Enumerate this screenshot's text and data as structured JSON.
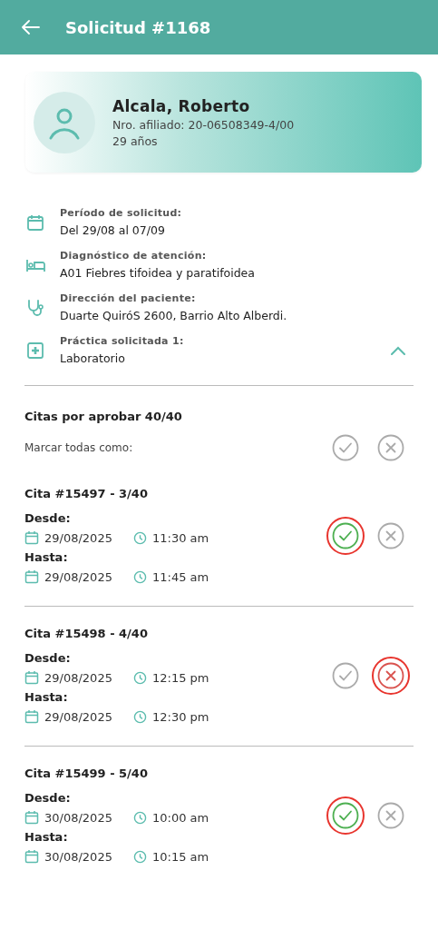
{
  "header": {
    "title": "Solicitud #1168"
  },
  "patient": {
    "name": "Alcala, Roberto",
    "affiliate": "Nro. afiliado: 20-06508349-4/00",
    "age": "29 años"
  },
  "details": [
    {
      "kind": "calendar",
      "label": "Período de solicitud:",
      "value": "Del 29/08 al 07/09"
    },
    {
      "kind": "bed",
      "label": "Diagnóstico de atención:",
      "value": "A01 Fiebres tifoidea y paratifoidea"
    },
    {
      "kind": "stethoscope",
      "label": "Dirección del paciente:",
      "value": "Duarte QuiróS  2600, Barrio Alto Alberdi."
    },
    {
      "kind": "plus",
      "label": "Práctica solicitada 1:",
      "value": "Laboratorio",
      "expanded": true
    }
  ],
  "appointments_section": {
    "title": "Citas por aprobar 40/40",
    "mark_all_label": "Marcar todas como:"
  },
  "appointments": [
    {
      "title": "Cita #15497 - 3/40",
      "from_label": "Desde:",
      "from_date": "29/08/2025",
      "from_time": "11:30 am",
      "to_label": "Hasta:",
      "to_date": "29/08/2025",
      "to_time": "11:45 am",
      "approved": true,
      "rejected": false
    },
    {
      "title": "Cita #15498 - 4/40",
      "from_label": "Desde:",
      "from_date": "29/08/2025",
      "from_time": "12:15 pm",
      "to_label": "Hasta:",
      "to_date": "29/08/2025",
      "to_time": "12:30 pm",
      "approved": false,
      "rejected": true
    },
    {
      "title": "Cita #15499 - 5/40",
      "from_label": "Desde:",
      "from_date": "30/08/2025",
      "from_time": "10:00 am",
      "to_label": "Hasta:",
      "to_date": "30/08/2025",
      "to_time": "10:15 am",
      "approved": true,
      "rejected": false
    }
  ]
}
